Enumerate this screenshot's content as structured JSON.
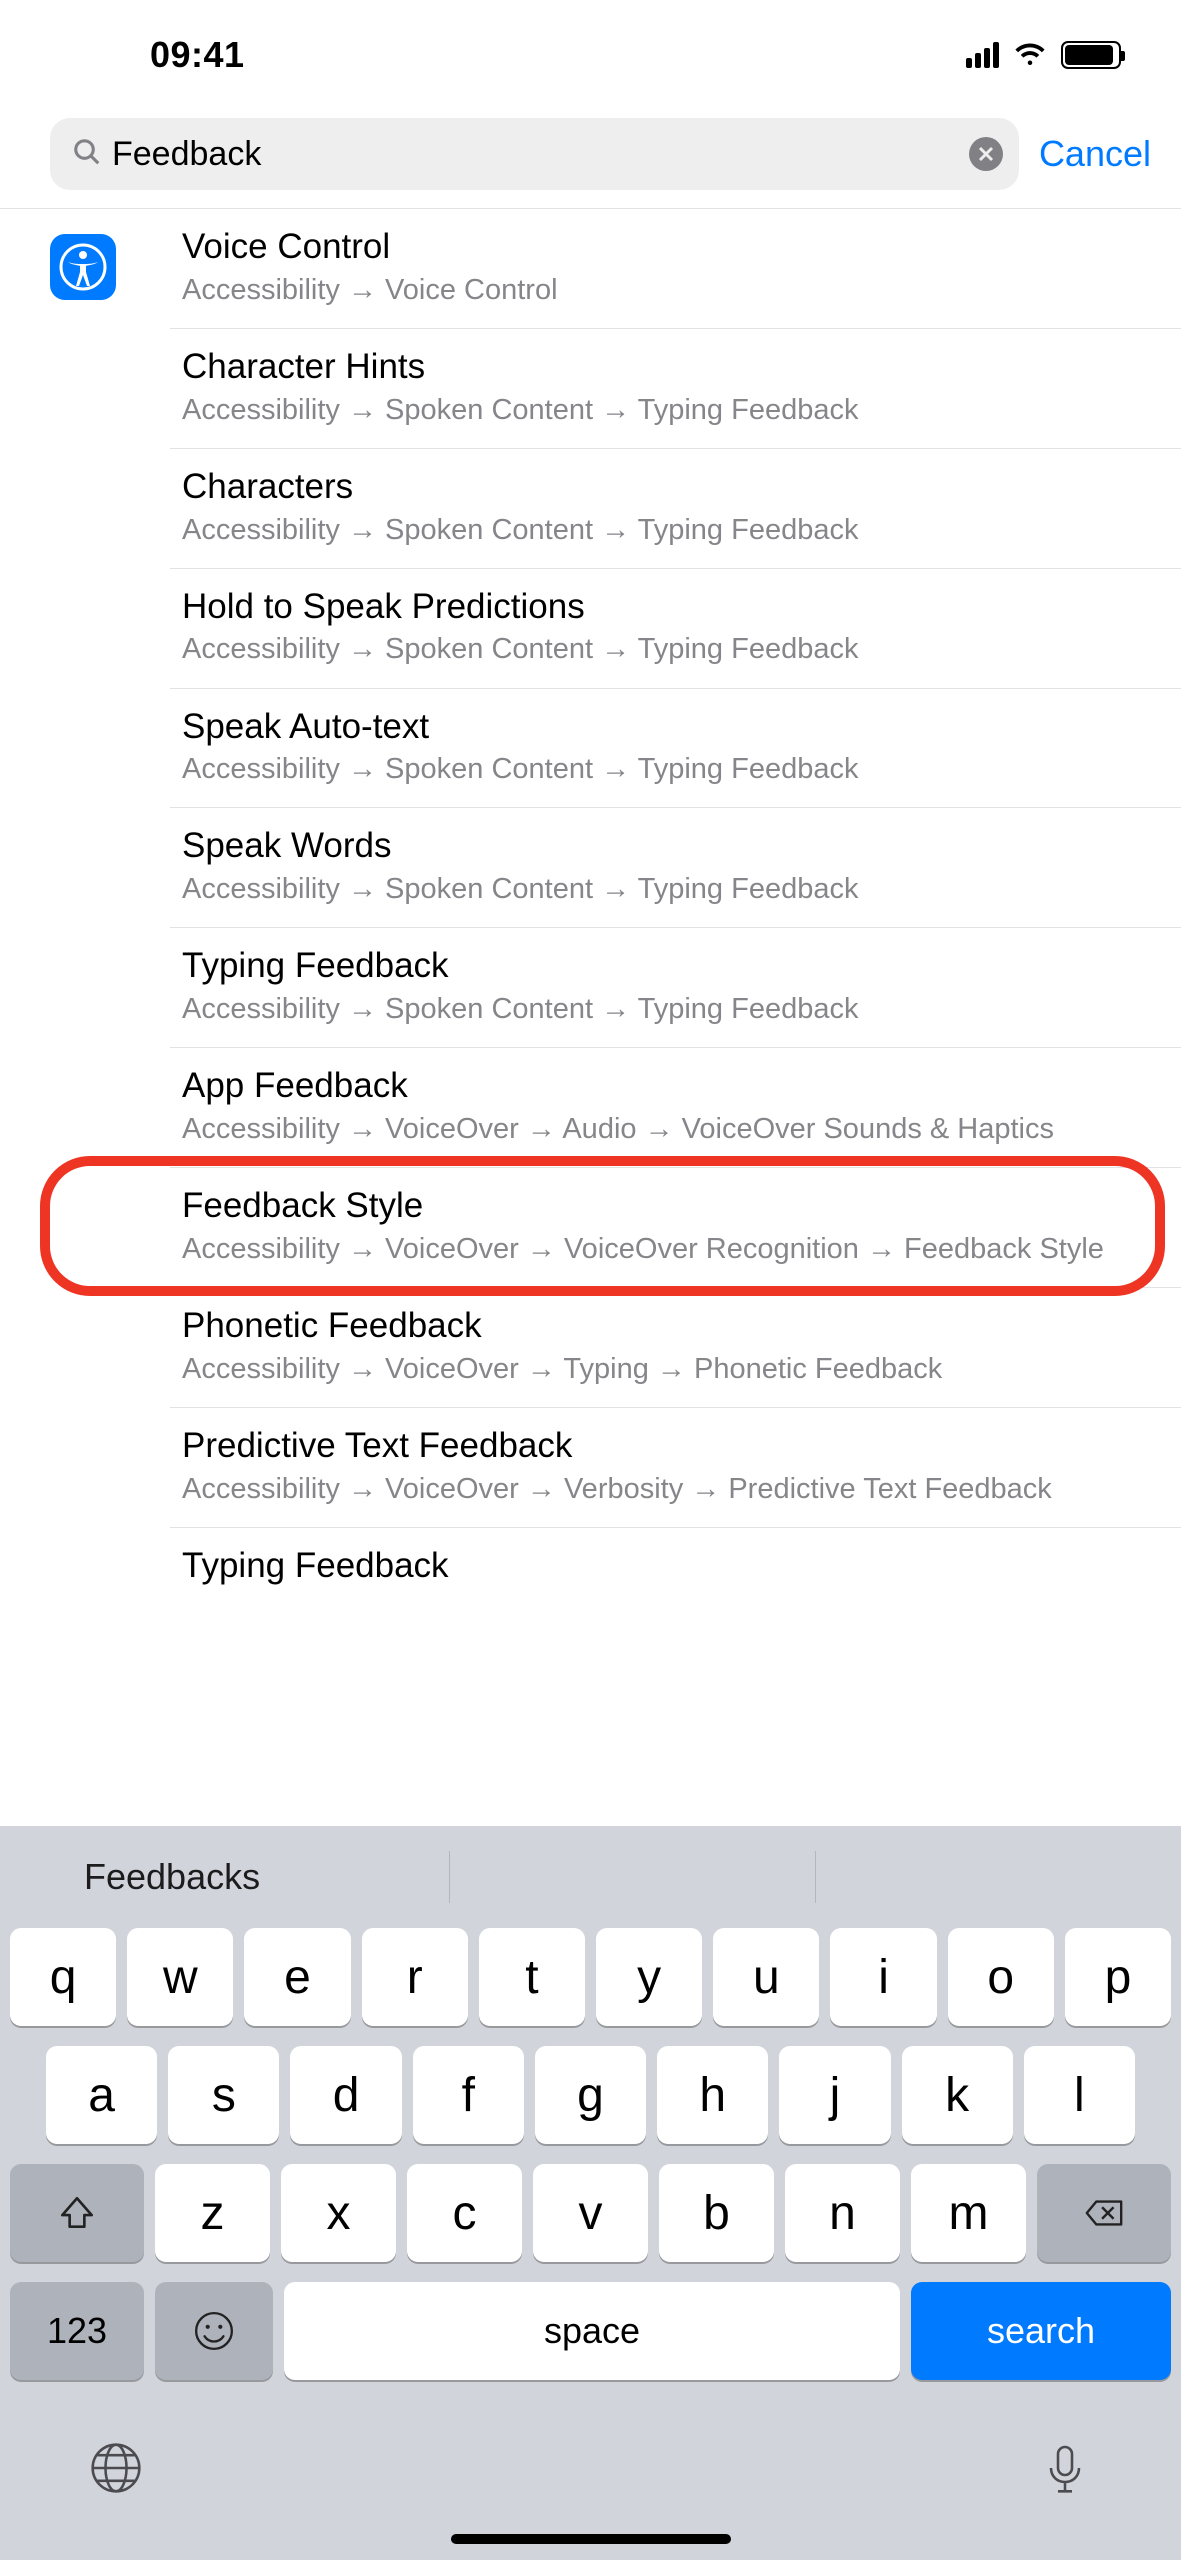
{
  "status": {
    "time": "09:41"
  },
  "search": {
    "value": "Feedback",
    "cancel": "Cancel"
  },
  "highlight_index": 8,
  "results": [
    {
      "title": "Voice Control",
      "path": "Accessibility → Voice Control"
    },
    {
      "title": "Character Hints",
      "path": "Accessibility → Spoken Content → Typing Feedback"
    },
    {
      "title": "Characters",
      "path": "Accessibility → Spoken Content → Typing Feedback"
    },
    {
      "title": "Hold to Speak Predictions",
      "path": "Accessibility → Spoken Content → Typing Feedback"
    },
    {
      "title": "Speak Auto-text",
      "path": "Accessibility → Spoken Content → Typing Feedback"
    },
    {
      "title": "Speak Words",
      "path": "Accessibility → Spoken Content → Typing Feedback"
    },
    {
      "title": "Typing Feedback",
      "path": "Accessibility → Spoken Content → Typing Feedback"
    },
    {
      "title": "App Feedback",
      "path": "Accessibility → VoiceOver → Audio → VoiceOver Sounds & Haptics"
    },
    {
      "title": "Feedback Style",
      "path": "Accessibility → VoiceOver → VoiceOver Recognition → Feedback Style"
    },
    {
      "title": "Phonetic Feedback",
      "path": "Accessibility → VoiceOver → Typing → Phonetic Feedback"
    },
    {
      "title": "Predictive Text Feedback",
      "path": "Accessibility → VoiceOver → Verbosity → Predictive Text Feedback"
    },
    {
      "title": "Typing Feedback",
      "path": ""
    }
  ],
  "keyboard": {
    "suggestion": "Feedbacks",
    "row1": [
      "q",
      "w",
      "e",
      "r",
      "t",
      "y",
      "u",
      "i",
      "o",
      "p"
    ],
    "row2": [
      "a",
      "s",
      "d",
      "f",
      "g",
      "h",
      "j",
      "k",
      "l"
    ],
    "row3": [
      "z",
      "x",
      "c",
      "v",
      "b",
      "n",
      "m"
    ],
    "numKey": "123",
    "space": "space",
    "search": "search"
  }
}
